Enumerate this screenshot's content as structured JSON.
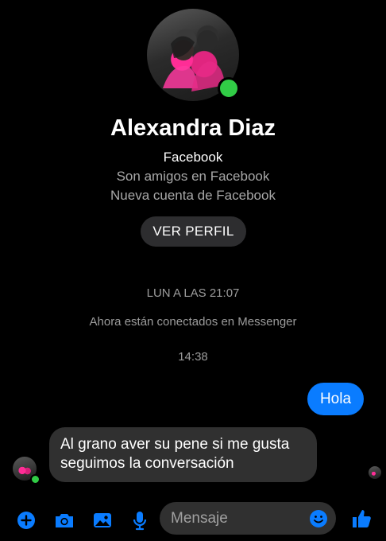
{
  "profile": {
    "name": "Alexandra Diaz",
    "source": "Facebook",
    "relationship": "Son amigos en Facebook",
    "account_note": "Nueva cuenta de Facebook",
    "view_profile_label": "VER PERFIL",
    "online": true
  },
  "conversation": {
    "timestamp_1": "LUN A LAS 21:07",
    "connected_note": "Ahora están conectados en Messenger",
    "timestamp_2": "14:38",
    "messages": [
      {
        "from": "me",
        "text": "Hola"
      },
      {
        "from": "them",
        "lines": [
          "Al grano aver su pene si me gusta",
          "seguimos la conversación"
        ]
      }
    ]
  },
  "composer": {
    "placeholder": "Mensaje",
    "icons": [
      "plus-icon",
      "camera-icon",
      "gallery-icon",
      "microphone-icon",
      "emoji-icon",
      "thumbs-up-icon"
    ]
  },
  "colors": {
    "background": "#000000",
    "accent": "#0a7cff",
    "online": "#31cc46",
    "incoming_bubble": "#303030"
  }
}
